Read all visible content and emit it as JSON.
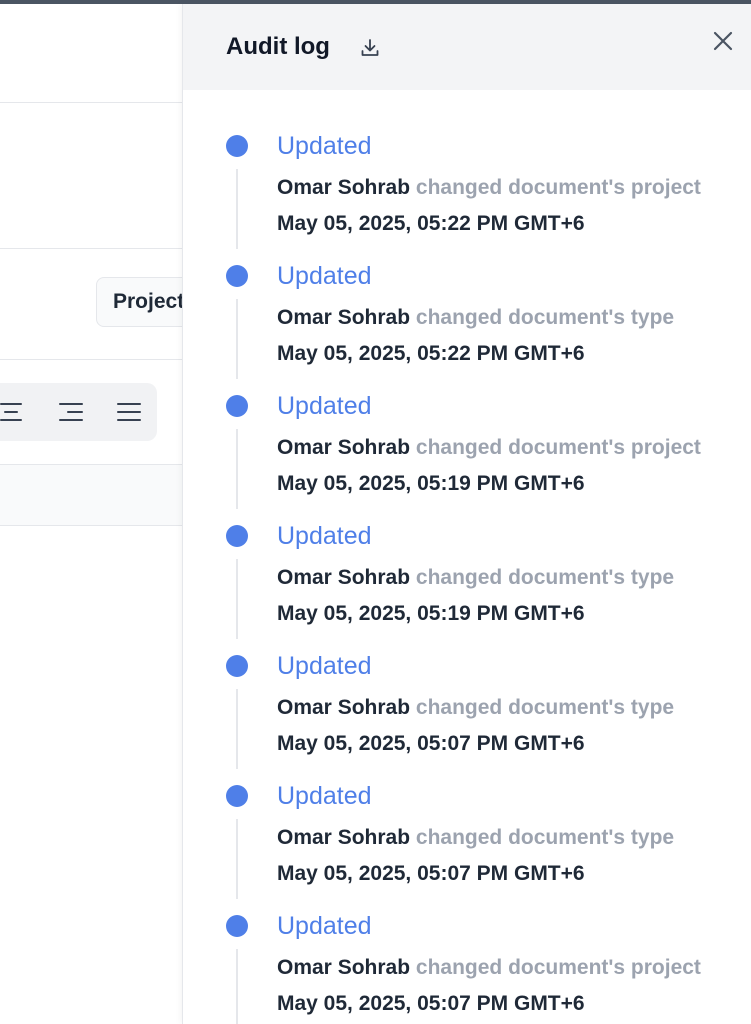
{
  "background": {
    "project_button_label": "Project"
  },
  "panel": {
    "title": "Audit log",
    "download_icon": "download-icon",
    "close_icon": "close-icon",
    "accent_color": "#4f7fe8"
  },
  "entries": [
    {
      "action": "Updated",
      "user": "Omar Sohrab",
      "change": "changed document's project",
      "time": "May 05, 2025, 05:22 PM GMT+6"
    },
    {
      "action": "Updated",
      "user": "Omar Sohrab",
      "change": "changed document's type",
      "time": "May 05, 2025, 05:22 PM GMT+6"
    },
    {
      "action": "Updated",
      "user": "Omar Sohrab",
      "change": "changed document's project",
      "time": "May 05, 2025, 05:19 PM GMT+6"
    },
    {
      "action": "Updated",
      "user": "Omar Sohrab",
      "change": "changed document's type",
      "time": "May 05, 2025, 05:19 PM GMT+6"
    },
    {
      "action": "Updated",
      "user": "Omar Sohrab",
      "change": "changed document's type",
      "time": "May 05, 2025, 05:07 PM GMT+6"
    },
    {
      "action": "Updated",
      "user": "Omar Sohrab",
      "change": "changed document's type",
      "time": "May 05, 2025, 05:07 PM GMT+6"
    },
    {
      "action": "Updated",
      "user": "Omar Sohrab",
      "change": "changed document's project",
      "time": "May 05, 2025, 05:07 PM GMT+6"
    }
  ]
}
